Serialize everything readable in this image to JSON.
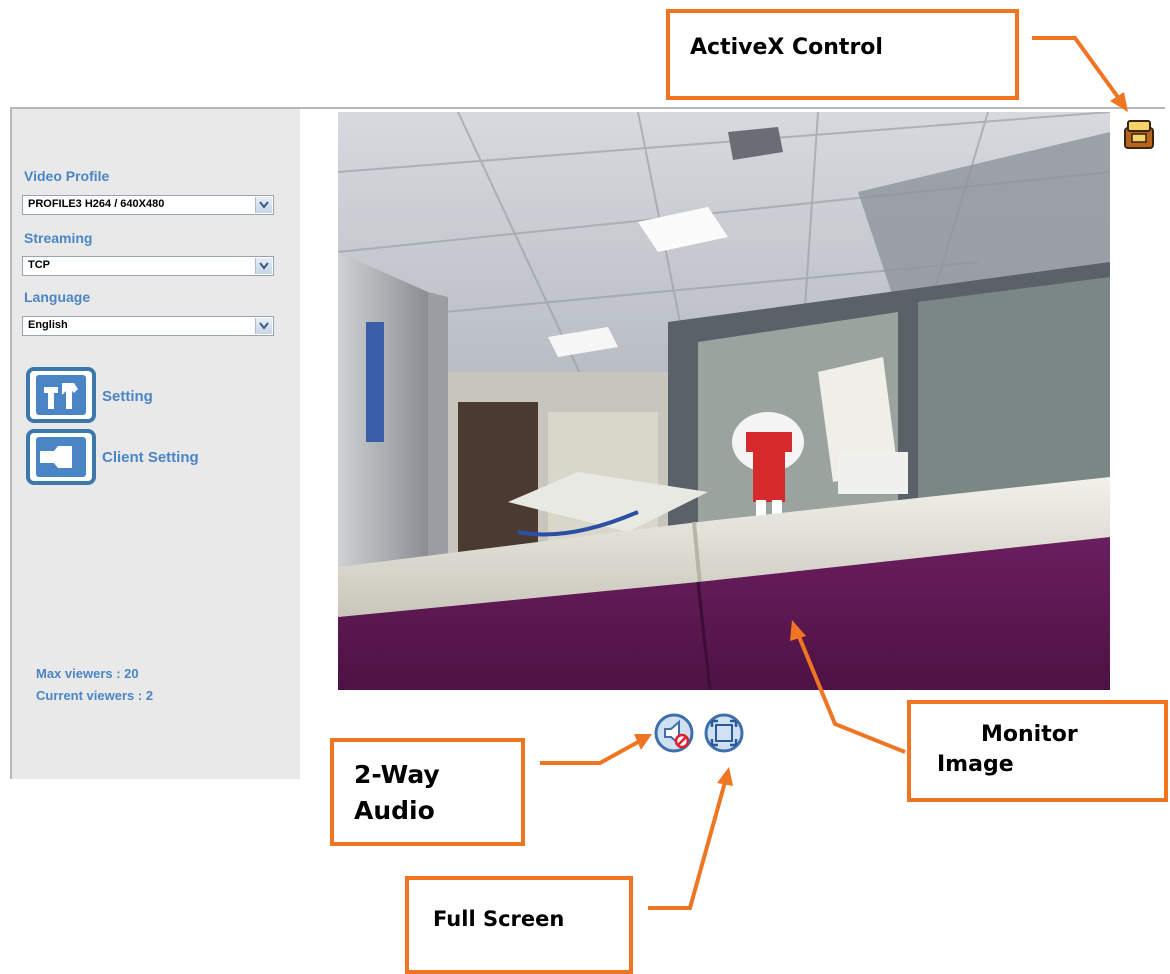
{
  "sidebar": {
    "video_profile": {
      "label": "Video Profile",
      "value": "PROFILE3 H264 / 640X480"
    },
    "streaming": {
      "label": "Streaming",
      "value": "TCP"
    },
    "language": {
      "label": "Language",
      "value": "English"
    },
    "nav": [
      {
        "label": "Setting",
        "icon": "tools-icon"
      },
      {
        "label": "Client Setting",
        "icon": "wrench-icon"
      }
    ],
    "max_viewers": "Max viewers : 20",
    "current_viewers": "Current viewers : 2"
  },
  "controls": {
    "audio_icon": "speaker-muted-icon",
    "fullscreen_icon": "fullscreen-icon",
    "activex_icon": "activex-control-icon"
  },
  "annotations": {
    "activex": "ActiveX Control",
    "monitor_line1": "Monitor",
    "monitor_line2": "Image",
    "audio_line1": "2-Way",
    "audio_line2": "Audio",
    "fullscreen": "Full Screen"
  },
  "colors": {
    "accent_text": "#4a86c5",
    "annotation_orange": "#f07522",
    "sidebar_bg": "#e9e9e9"
  }
}
